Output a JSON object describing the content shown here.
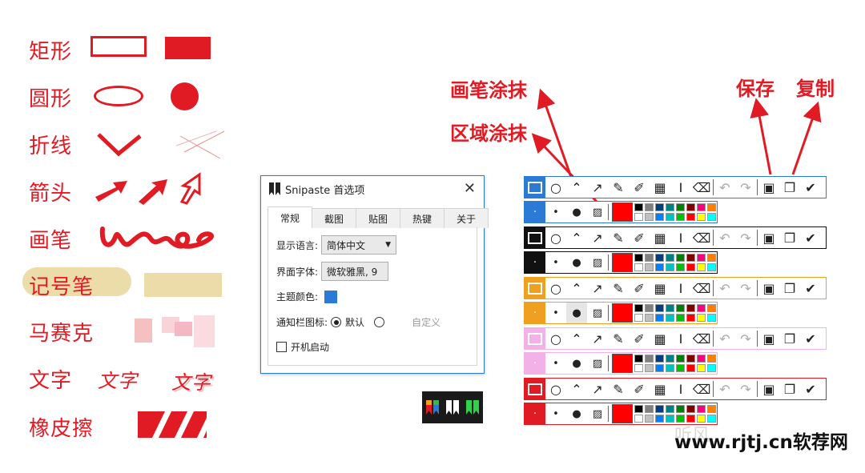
{
  "tools_legend": [
    {
      "label": "矩形"
    },
    {
      "label": "圆形"
    },
    {
      "label": "折线"
    },
    {
      "label": "箭头"
    },
    {
      "label": "画笔"
    },
    {
      "label": "记号笔"
    },
    {
      "label": "马赛克"
    },
    {
      "label": "文字",
      "samples": [
        "文字",
        "文字"
      ]
    },
    {
      "label": "橡皮擦"
    }
  ],
  "colors": {
    "accent_red": "#e11b24",
    "marker_yellow": "#ecdcaa",
    "dialog_blue": "#2b7ad6"
  },
  "dialog": {
    "title": "Snipaste 首选项",
    "tabs": [
      "常规",
      "截图",
      "贴图",
      "热键",
      "关于"
    ],
    "language_label": "显示语言:",
    "language_value": "简体中文",
    "font_label": "界面字体:",
    "font_value": "微软雅黑, 9",
    "theme_label": "主题颜色:",
    "theme_color": "#2b7ad6",
    "tray_label": "通知栏图标:",
    "tray_default": "默认",
    "tray_custom": "自定义",
    "startup_label": "开机启动"
  },
  "annotations": {
    "brush_smear": "画笔涂抹",
    "area_smear": "区域涂抹",
    "save": "保存",
    "copy": "复制"
  },
  "toolbar_themes": [
    "#2b7ad6",
    "#111111",
    "#f0a020",
    "#f2b2e8",
    "#e11b24"
  ],
  "watermark": {
    "left": "听风",
    "right": "www.rjtj.cn软荐网"
  }
}
